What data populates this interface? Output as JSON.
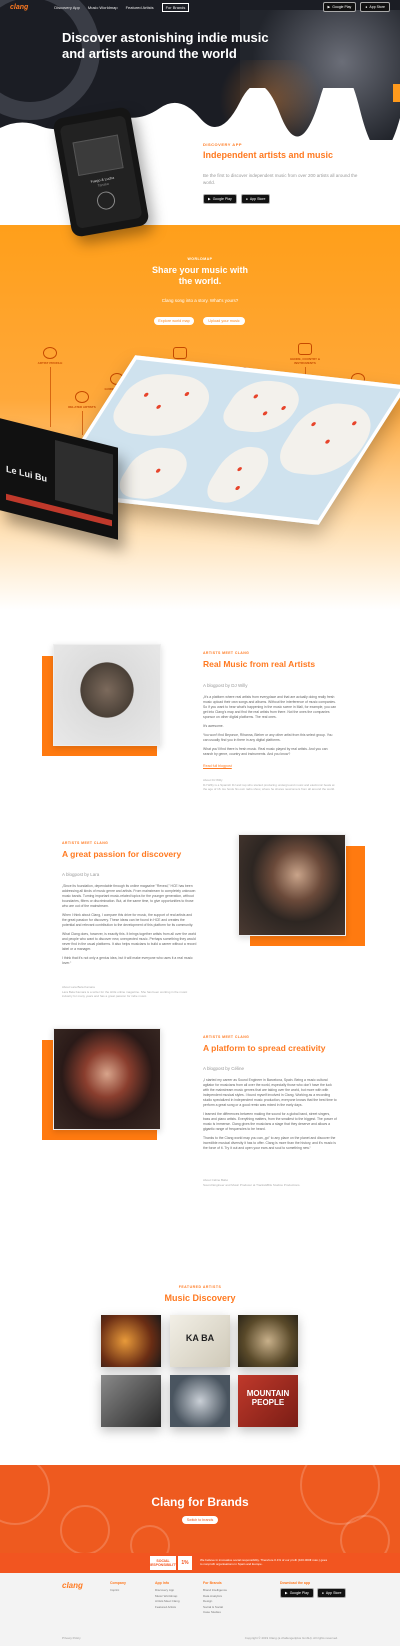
{
  "nav": {
    "logo": "clang",
    "links": [
      "Discovery App",
      "Music Worldmap",
      "Featured Artists"
    ],
    "brands_btn": "For Brands",
    "google_play": "Google Play",
    "app_store": "App Store"
  },
  "hero": {
    "title": "Discover astonishing indie music and artists around the world"
  },
  "phone": {
    "artist": "Fuego & Lucha",
    "track": "Tanaka"
  },
  "intro": {
    "tag": "DISCOVERY APP",
    "title": "Independent artists and music",
    "text": "Be the first to discover independent music from over 200 artists all around the world.",
    "google_play": "Google Play",
    "app_store": "App Store"
  },
  "worldmap": {
    "tag": "WORLDMAP",
    "title": "Share your music with the world.",
    "subtitle": "Clang song into a story. What's yours?",
    "btn1": "Explore world map",
    "btn2": "Upload your music",
    "features": [
      "ARTIST PROFILE",
      "RELATED ARTISTS",
      "GUIDE / STORIES",
      "MUSIC PLAYER",
      "MUSIC WORLDMAP",
      "GENRE, COUNTRY & INSTRUMENTS",
      "ARTIST DISCOVERY"
    ],
    "laptop_text": "Le Lui Bu"
  },
  "articles": [
    {
      "tag": "ARTISTS MEET CLANG",
      "title": "Real Music from real Artists",
      "by": "A blogpost by DJ Willy",
      "body": [
        "„It's a platform where real artists from everyplace and that are actually doing really fresh music upload their own songs and albums. Without the interference of music companies. So if you want to hear what's happening in the music scene in Mali, for example, you can get into Clang's map and find the real artists from there. Not the ones the companies sponsor on other digital platforms. The real ones.",
        "It's awesome.",
        "You won't find Beyonce, Rihanna, Bieber or any other artist from this select group. You can usually find you in there in any digital platforms.",
        "What you'll find there is fresh music. Real music played by real artists. And you can search by genre, country and instruments. And you know?"
      ],
      "link": "Read full blogpost",
      "note_head": "About DJ Willy",
      "note": "DJ Willy is a Spanish DJ and rap who started producing underground music and electronic beats at the age of 16. He hosts his own radio show, where he shares newcomers from all around the world."
    },
    {
      "tag": "ARTISTS MEET CLANG",
      "title": "A great passion for discovery",
      "by": "A blogpost by Lara",
      "body": [
        "„Since its foundation, dependable through its online magazine \"Reveal,\" HCE has been addressing all kinds of music genre and artists. From mainstream to completely unknown music bands. Turning important music-related topics for the younger generation, without boundaries, filters or discrimination. But, at the same time, to give opportunities to those who are out of the mainstream.",
        "When I think about Clang, I compare this drive for music, the support of real artists and the great passion for discovery. These ideas can be found in HCE and creates the potential and relevant contribution to the development of this platform for its community.",
        "What Clang does, however, is exactly this. It brings together artists from all over the world and people who want to discover new, unexpected music. Perhaps something they would never find in the usual platforms. It also helps musicians to build a career without a record label or a manager.",
        "I think that it's not only a genius idea, but it will make everyone who uses it a real music lover.“"
      ],
      "note_head": "About Lara Bela Kamara",
      "note": "Lara Bela Kamara is a writer for the HCE online magazine. She has been working in the music industry for many years and has a great passion for indie music."
    },
    {
      "tag": "ARTISTS MEET CLANG",
      "title": "A platform to spread creativity",
      "by": "A blogpost by Céline",
      "body": [
        "„I started my career as Sound Engineer in Barcelona, Spain. Being a music cultural agitator for musicians from all over the world, especially those who don't have the luck with the mainstream music genres that are taking over the world, but more with with independent musical styles. I found myself involved in Clang. Working as a recording studio specialized in independent music production, everyone knows that the best time to perform a great song or a good remix was mixed in the early days.",
        "I learned the differences between making the sound for a global band, street singers, bass and piano artists. Everything matters, from the smallest to the biggest. The power of music is immense. Clang gives the musicians a stage that they deserve and allows a gigantic range of frequencies to be heard.",
        "Thanks to the Clang world map you can „go\" to any place on the planet and discover the incredible musical diversity it has to offer. Clang is more than the history, and it's music is the force of it. Try it out and open your ears and soul to something new.“"
      ],
      "note_head": "About Céline Babé",
      "note": "Sound Engineer and Music Producer at Tracks&Bits Studios Productions."
    }
  ],
  "featured": {
    "tag": "FEATURED ARTISTS",
    "title": "Music Discovery",
    "tiles": [
      {
        "caption": ""
      },
      {
        "caption": "KA BA"
      },
      {
        "caption": ""
      },
      {
        "caption": ""
      },
      {
        "caption": ""
      },
      {
        "caption": "MOUNTAIN PEOPLE"
      }
    ]
  },
  "brands": {
    "title": "Clang for Brands",
    "btn": "Switch to brands"
  },
  "social": {
    "logo": "SOCIAL RESPONSIBILITY",
    "badge": "1%",
    "text": "We believe in innovative social responsibility. Therefore 0.1% of our profit (100.000€ max.) goes to nonprofit organisations in Spain and Europe."
  },
  "footer": {
    "logo": "clang",
    "columns": [
      {
        "head": "Company",
        "items": [
          "Imprint"
        ]
      },
      {
        "head": "App Info",
        "items": [
          "Discovery App",
          "Music Worldmap",
          "Artists Meet Clang",
          "Featured Artists"
        ]
      },
      {
        "head": "For Brands",
        "items": [
          "Brand Intelligence",
          "Data Analytics",
          "Design",
          "Social & Social",
          "Case Studies"
        ]
      },
      {
        "head": "Download the app",
        "items": []
      }
    ],
    "google_play": "Google Play",
    "app_store": "App Store",
    "privacy": "Privacy Policy",
    "copyright": "Copyright © 2019 Clang (a challenge4plus GmbH). All rights reserved."
  }
}
